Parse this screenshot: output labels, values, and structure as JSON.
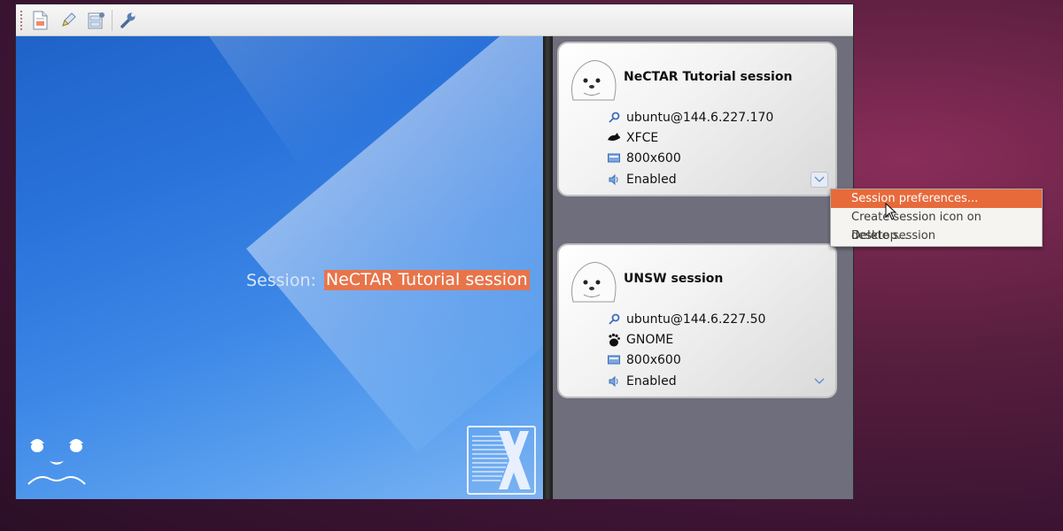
{
  "toolbar": {
    "buttons": [
      {
        "name": "new-session-icon"
      },
      {
        "name": "edit-pencil-icon"
      },
      {
        "name": "session-settings-icon"
      },
      {
        "name": "wrench-icon"
      }
    ]
  },
  "preview": {
    "label": "Session:",
    "value": "NeCTAR Tutorial session",
    "accent": "#e8744a"
  },
  "sessions": [
    {
      "title": "NeCTAR Tutorial session",
      "server": "ubuntu@144.6.227.170",
      "desktop": "XFCE",
      "resolution": "800x600",
      "sound": "Enabled"
    },
    {
      "title": "UNSW session",
      "server": "ubuntu@144.6.227.50",
      "desktop": "GNOME",
      "resolution": "800x600",
      "sound": "Enabled"
    }
  ],
  "context_menu": {
    "items": [
      "Session preferences...",
      "Create session icon on desktop...",
      "Delete session"
    ],
    "selected_index": 0,
    "highlight_color": "#e76a3b"
  }
}
